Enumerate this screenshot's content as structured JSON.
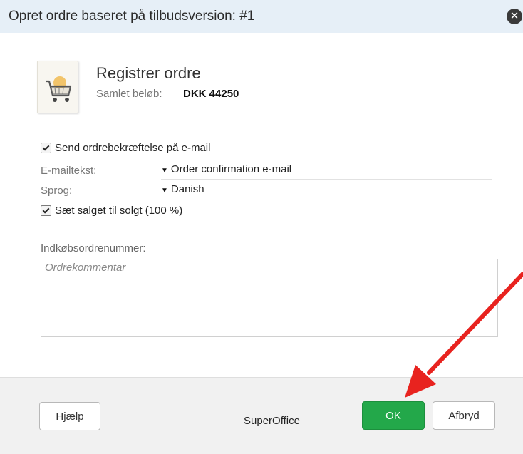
{
  "dialog": {
    "title": "Opret ordre baseret på tilbudsversion: #1",
    "close_glyph": "✕"
  },
  "header": {
    "icon": "shopping-cart-icon",
    "heading": "Registrer ordre",
    "total_label": "Samlet beløb:",
    "total_value": "DKK 44250"
  },
  "form": {
    "send_confirmation": {
      "label": "Send ordrebekræftelse på e-mail",
      "checked": true
    },
    "email_text": {
      "label": "E-mailtekst:",
      "value": "Order confirmation e-mail"
    },
    "language": {
      "label": "Sprog:",
      "value": "Danish"
    },
    "set_sold": {
      "label": "Sæt salget til solgt (100 %)",
      "checked": true
    },
    "po_number": {
      "label": "Indkøbsordrenummer:",
      "value": ""
    },
    "comment": {
      "placeholder": "Ordrekommentar",
      "value": ""
    }
  },
  "footer": {
    "help_label": "Hjælp",
    "brand": "SuperOffice",
    "ok_label": "OK",
    "cancel_label": "Afbryd"
  },
  "colors": {
    "titlebar": "#e6eff7",
    "ok_button": "#23a84a",
    "annotation_arrow": "#e8231f",
    "footer": "#f1f1f1"
  }
}
